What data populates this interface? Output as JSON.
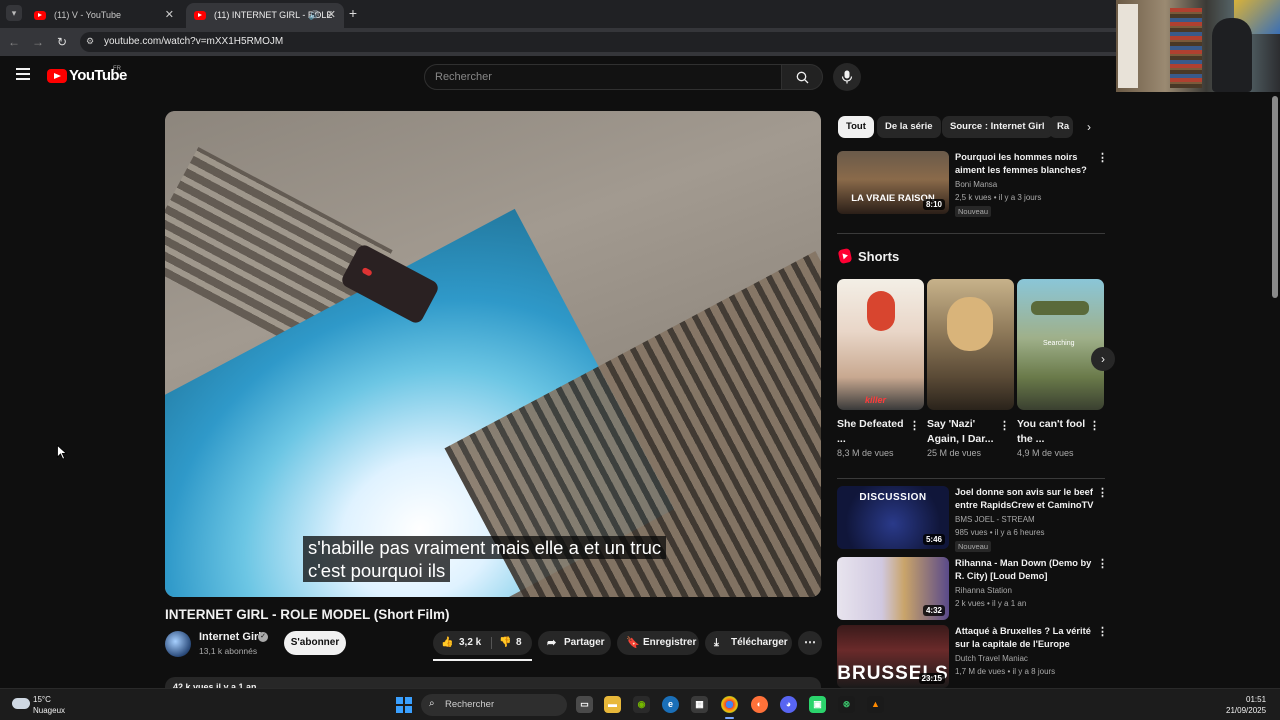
{
  "browser": {
    "tabs": [
      {
        "label": "(11) V - YouTube",
        "active": false
      },
      {
        "label": "(11) INTERNET GIRL - ROLE",
        "active": true
      }
    ],
    "tab_list_icon": "chevron-down-icon",
    "new_tab_icon": "plus-icon",
    "url": "youtube.com/watch?v=mXX1H5RMOJM"
  },
  "masthead": {
    "logo_text": "YouTube",
    "region": "FR",
    "search_placeholder": "Rechercher"
  },
  "video": {
    "caption_line1": "s'habille pas vraiment mais elle a et un truc",
    "caption_line2": "c'est pourquoi ils",
    "title": "INTERNET GIRL - ROLE MODEL (Short Film)",
    "channel": "Internet Girl",
    "subscribers": "13,1 k abonnés",
    "subscribe_label": "S'abonner",
    "likes": "3,2 k",
    "dislikes": "8",
    "share_label": "Partager",
    "save_label": "Enregistrer",
    "download_label": "Télécharger",
    "description_meta": "42 k vues  il y a 1 an"
  },
  "chips": [
    "Tout",
    "De la série",
    "Source : Internet Girl",
    "Ra"
  ],
  "recommendations_top": [
    {
      "title": "Pourquoi les hommes noirs aiment les femmes blanches?",
      "channel": "Boni Mansa",
      "meta": "2,5 k vues  •  il y a 3 jours",
      "badge": "Nouveau",
      "duration": "8:10",
      "thumb_text": "LA VRAIE RAISON"
    }
  ],
  "shorts": {
    "heading": "Shorts",
    "items": [
      {
        "title": "She Defeated ...",
        "views": "8,3 M de vues",
        "thumb_text": "killer"
      },
      {
        "title": "Say 'Nazi' Again, I Dar...",
        "views": "25 M de vues",
        "thumb_text": ""
      },
      {
        "title": "You can't fool the ...",
        "views": "4,9 M de vues",
        "thumb_text": "Searching"
      }
    ]
  },
  "recommendations": [
    {
      "title": "Joel donne son avis sur le beef entre RapidsCrew et CaminoTV",
      "channel": "BMS JOEL - STREAM",
      "meta": "985 vues  •  il y a 6 heures",
      "badge": "Nouveau",
      "duration": "5:46",
      "thumb_text": "DISCUSSION"
    },
    {
      "title": "Rihanna - Man Down (Demo by R. City) [Loud Demo]",
      "channel": "Rihanna Station",
      "meta": "2 k vues  •  il y a 1 an",
      "badge": "",
      "duration": "4:32",
      "thumb_text": ""
    },
    {
      "title": "Attaqué à Bruxelles ? La vérité sur la capitale de l'Europe",
      "channel": "Dutch Travel Maniac",
      "meta": "1,7 M de vues  •  il y a 8 jours",
      "badge": "",
      "duration": "23:15",
      "thumb_text": "BRUSSELS"
    }
  ],
  "taskbar": {
    "temperature": "15°C",
    "condition": "Nuageux",
    "search_placeholder": "Rechercher",
    "time": "01:51",
    "date": "21/09/2025"
  }
}
